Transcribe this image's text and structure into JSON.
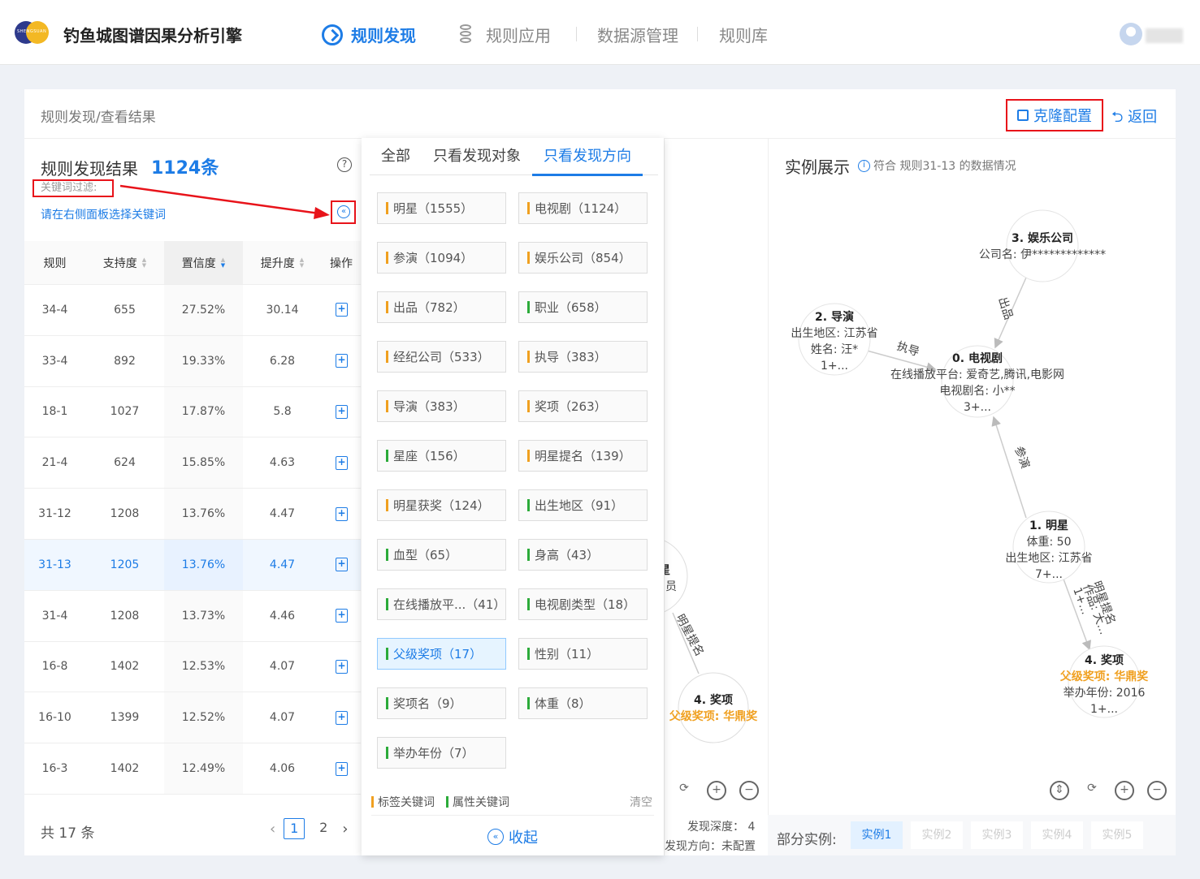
{
  "app": {
    "title": "钓鱼城图谱因果分析引擎",
    "logo_text": "SHENGSUAN"
  },
  "nav": [
    {
      "label": "规则发现"
    },
    {
      "label": "规则应用"
    },
    {
      "label": "数据源管理"
    },
    {
      "label": "规则库"
    }
  ],
  "breadcrumb": "规则发现/查看结果",
  "actions": {
    "clone": "克隆配置",
    "back": "返回"
  },
  "results": {
    "title": "规则发现结果",
    "count": "1124条",
    "keyword_filter": "关键词过滤:",
    "keyword_hint": "请在右侧面板选择关键词"
  },
  "table": {
    "headers": [
      "规则",
      "支持度",
      "置信度",
      "提升度",
      "操作"
    ],
    "rows": [
      [
        "34-4",
        "655",
        "27.52%",
        "30.14"
      ],
      [
        "33-4",
        "892",
        "19.33%",
        "6.28"
      ],
      [
        "18-1",
        "1027",
        "17.87%",
        "5.8"
      ],
      [
        "21-4",
        "624",
        "15.85%",
        "4.63"
      ],
      [
        "31-12",
        "1208",
        "13.76%",
        "4.47"
      ],
      [
        "31-13",
        "1205",
        "13.76%",
        "4.47"
      ],
      [
        "31-4",
        "1208",
        "13.73%",
        "4.46"
      ],
      [
        "16-8",
        "1402",
        "12.53%",
        "4.07"
      ],
      [
        "16-10",
        "1399",
        "12.52%",
        "4.07"
      ],
      [
        "16-3",
        "1402",
        "12.49%",
        "4.06"
      ]
    ],
    "selected_row": 5
  },
  "pagination": {
    "total": "共 17 条",
    "pages": [
      "1",
      "2"
    ],
    "current": "1"
  },
  "keyword_panel": {
    "tabs": [
      "全部",
      "只看发现对象",
      "只看发现方向"
    ],
    "active_tab": 2,
    "chips": [
      {
        "label": "明星（1555）",
        "type": "tag"
      },
      {
        "label": "电视剧（1124）",
        "type": "tag"
      },
      {
        "label": "参演（1094）",
        "type": "tag"
      },
      {
        "label": "娱乐公司（854）",
        "type": "tag"
      },
      {
        "label": "出品（782）",
        "type": "tag"
      },
      {
        "label": "职业（658）",
        "type": "attr"
      },
      {
        "label": "经纪公司（533）",
        "type": "tag"
      },
      {
        "label": "执导（383）",
        "type": "tag"
      },
      {
        "label": "导演（383）",
        "type": "tag"
      },
      {
        "label": "奖项（263）",
        "type": "tag"
      },
      {
        "label": "星座（156）",
        "type": "attr"
      },
      {
        "label": "明星提名（139）",
        "type": "tag"
      },
      {
        "label": "明星获奖（124）",
        "type": "tag"
      },
      {
        "label": "出生地区（91）",
        "type": "attr"
      },
      {
        "label": "血型（65）",
        "type": "attr"
      },
      {
        "label": "身高（43）",
        "type": "attr"
      },
      {
        "label": "在线播放平...（41）",
        "type": "attr"
      },
      {
        "label": "电视剧类型（18）",
        "type": "attr"
      },
      {
        "label": "父级奖项（17）",
        "type": "attr",
        "selected": true
      },
      {
        "label": "性别（11）",
        "type": "attr"
      },
      {
        "label": "奖项名（9）",
        "type": "attr"
      },
      {
        "label": "体重（8）",
        "type": "attr"
      },
      {
        "label": "举办年份（7）",
        "type": "attr"
      }
    ],
    "legend": {
      "tag": "标签关键词",
      "attr": "属性关键词"
    },
    "clear": "清空",
    "collapse": "收起",
    "colors": {
      "tag": "#f0a020",
      "attr": "#2cab3a"
    }
  },
  "mid_graph": {
    "partial_labels": [
      "星",
      "员"
    ],
    "edge": "明星提名",
    "node_title": "4. 奖项",
    "node_attr": "父级奖项: 华鼎奖",
    "info": [
      {
        "label": "发现深度：",
        "value": "4"
      },
      {
        "label": "发现方向：",
        "value": "未配置"
      }
    ]
  },
  "example": {
    "title": "实例展示",
    "subtitle": "符合 规则31-13 的数据情况",
    "nodes": [
      {
        "title": "3. 娱乐公司",
        "lines": [
          "公司名: 伊*************"
        ]
      },
      {
        "title": "2. 导演",
        "lines": [
          "出生地区: 江苏省",
          "姓名: 汪*",
          "1+..."
        ]
      },
      {
        "title": "0. 电视剧",
        "lines": [
          "在线播放平台: 爱奇艺,腾讯,电影网",
          "电视剧名: 小**",
          "3+..."
        ]
      },
      {
        "title": "1. 明星",
        "lines": [
          "体重: 50",
          "出生地区: 江苏省",
          "7+..."
        ]
      },
      {
        "title": "4. 奖项",
        "highlight": "父级奖项: 华鼎奖",
        "lines": [
          "举办年份: 2016",
          "1+..."
        ]
      }
    ],
    "edges": [
      "出品",
      "执导",
      "参演",
      "明星提名",
      "作品: 大..."
    ],
    "edge_extra": "1+..."
  },
  "instances": {
    "label": "部分实例:",
    "items": [
      "实例1",
      "实例2",
      "实例3",
      "实例4",
      "实例5"
    ],
    "active": 0
  }
}
